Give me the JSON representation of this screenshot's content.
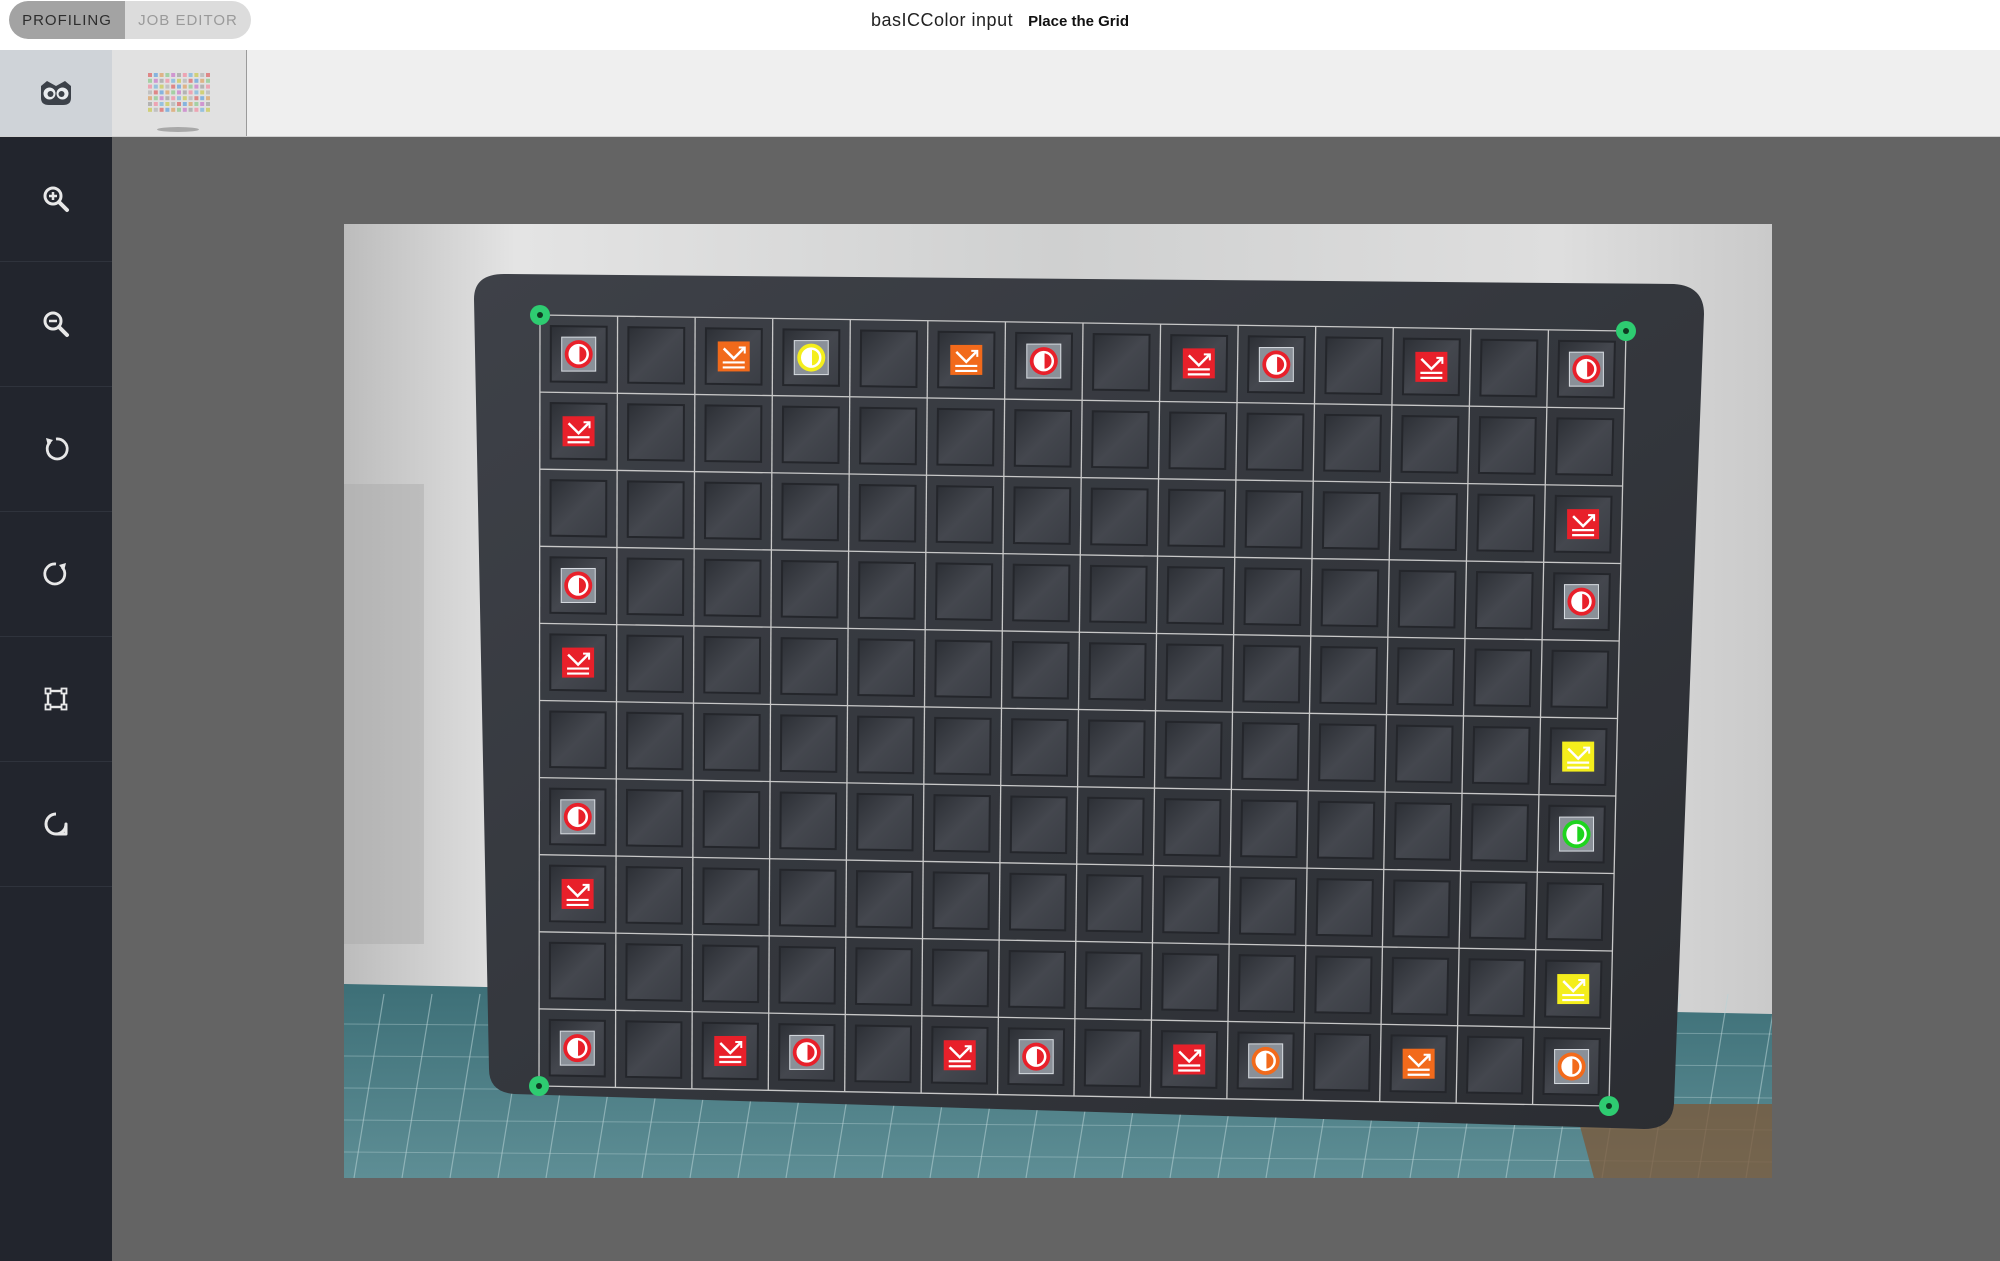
{
  "header": {
    "app_name": "basICColor input",
    "step_title": "Place the Grid",
    "modes": [
      {
        "label": "PROFILING",
        "active": true
      },
      {
        "label": "JOB EDITOR",
        "active": false
      }
    ]
  },
  "tabs": [
    {
      "icon": "owl-icon",
      "selected": true
    },
    {
      "icon": "color-chart-thumbnail-icon",
      "selected": false
    }
  ],
  "tools": [
    {
      "icon": "zoom-in-icon"
    },
    {
      "icon": "zoom-out-icon"
    },
    {
      "icon": "rotate-left-icon"
    },
    {
      "icon": "rotate-right-icon"
    },
    {
      "icon": "fit-frame-icon"
    },
    {
      "icon": "reset-view-icon"
    }
  ],
  "grid": {
    "columns": 14,
    "rows": 10,
    "markers": [
      {
        "row": 1,
        "col": 1,
        "type": "circle",
        "color": "#e8202a"
      },
      {
        "row": 1,
        "col": 3,
        "type": "arrow",
        "color": "#f26a1b"
      },
      {
        "row": 1,
        "col": 4,
        "type": "circle",
        "color": "#f4ee1c"
      },
      {
        "row": 1,
        "col": 6,
        "type": "arrow",
        "color": "#f26a1b"
      },
      {
        "row": 1,
        "col": 7,
        "type": "circle",
        "color": "#e8202a"
      },
      {
        "row": 1,
        "col": 9,
        "type": "arrow",
        "color": "#e8202a"
      },
      {
        "row": 1,
        "col": 10,
        "type": "circle",
        "color": "#e8202a"
      },
      {
        "row": 1,
        "col": 12,
        "type": "arrow",
        "color": "#e8202a"
      },
      {
        "row": 1,
        "col": 14,
        "type": "circle",
        "color": "#e8202a"
      },
      {
        "row": 2,
        "col": 1,
        "type": "arrow",
        "color": "#e8202a"
      },
      {
        "row": 3,
        "col": 14,
        "type": "arrow",
        "color": "#e8202a"
      },
      {
        "row": 4,
        "col": 1,
        "type": "circle",
        "color": "#e8202a"
      },
      {
        "row": 4,
        "col": 14,
        "type": "circle",
        "color": "#e8202a"
      },
      {
        "row": 5,
        "col": 1,
        "type": "arrow",
        "color": "#e8202a"
      },
      {
        "row": 6,
        "col": 14,
        "type": "arrow",
        "color": "#f4ee1c"
      },
      {
        "row": 7,
        "col": 1,
        "type": "circle",
        "color": "#e8202a"
      },
      {
        "row": 7,
        "col": 14,
        "type": "circle",
        "color": "#1ed41e"
      },
      {
        "row": 8,
        "col": 1,
        "type": "arrow",
        "color": "#e8202a"
      },
      {
        "row": 9,
        "col": 14,
        "type": "arrow",
        "color": "#f4ee1c"
      },
      {
        "row": 10,
        "col": 1,
        "type": "circle",
        "color": "#e8202a"
      },
      {
        "row": 10,
        "col": 3,
        "type": "arrow",
        "color": "#e8202a"
      },
      {
        "row": 10,
        "col": 4,
        "type": "circle",
        "color": "#e8202a"
      },
      {
        "row": 10,
        "col": 6,
        "type": "arrow",
        "color": "#e8202a"
      },
      {
        "row": 10,
        "col": 7,
        "type": "circle",
        "color": "#e8202a"
      },
      {
        "row": 10,
        "col": 9,
        "type": "arrow",
        "color": "#e8202a"
      },
      {
        "row": 10,
        "col": 10,
        "type": "circle",
        "color": "#f26a1b"
      },
      {
        "row": 10,
        "col": 12,
        "type": "arrow",
        "color": "#f26a1b"
      },
      {
        "row": 10,
        "col": 14,
        "type": "circle",
        "color": "#f26a1b"
      }
    ],
    "corner_handle_color": "#2ecc71",
    "grid_line_color": "#c8c8c8"
  }
}
